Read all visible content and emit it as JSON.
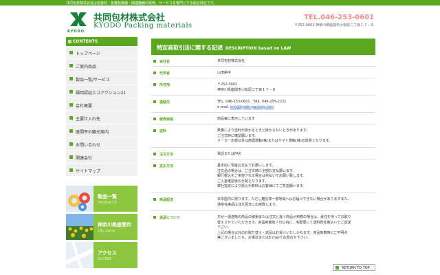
{
  "topbar": {
    "text": "共同包材株式会社は包装材・各種包装機・関連機器の販売、サービスを専門とする総合商社です。"
  },
  "header": {
    "logo_jp": "共同包材株式会社",
    "logo_en": "KYODO Packing materials",
    "logo_mark_text": "KYODO",
    "tel": "TEL.046-253-0601",
    "address": "〒252-0002 神奈川県座間市小松原二丁目１７－８"
  },
  "sidebar": {
    "heading": "CONTENTS",
    "items": [
      {
        "label": "トップページ"
      },
      {
        "label": "ご案内商品"
      },
      {
        "label": "製品一覧/サービス"
      },
      {
        "label": "福岡認証エコアクション21"
      },
      {
        "label": "会社概要"
      },
      {
        "label": "主要仕入れ先"
      },
      {
        "label": "座間市の観光案内"
      },
      {
        "label": "お問い合わせ"
      },
      {
        "label": "関連会社"
      },
      {
        "label": "サイトマップ"
      }
    ]
  },
  "banners": [
    {
      "title": "製品一覧",
      "sub": "PRODUCTS"
    },
    {
      "title": "神奈川県座間市",
      "sub": "City zama"
    },
    {
      "title": "アクセス",
      "sub": "ACCESS"
    }
  ],
  "main": {
    "title": "特定商取引法に関する記述",
    "title_en": "DESCRIPTION based on LAW",
    "rows": [
      {
        "label": "会社名",
        "lines": [
          "共同包材株式会社"
        ]
      },
      {
        "label": "代表者",
        "lines": [
          "山田耕平"
        ]
      },
      {
        "label": "所在地",
        "lines": [
          "〒252-0002",
          "神奈川県座間市小松原二丁目１７－８"
        ]
      },
      {
        "label": "連絡先",
        "lines": [
          "TEL. 046-253-0601　FAX. 046-255-2221"
        ],
        "email_prefix": "e-mail. ",
        "email": "info@kyodo-packing.com"
      },
      {
        "label": "販売価格",
        "lines": [
          "商品毎に表示しています"
        ]
      },
      {
        "label": "送料",
        "lines": [
          "数量により送料が掛かるときと掛からないときがあります。",
          "ご注文時に確認願います。",
          "メーカー出荷以外は西濃運輸(株)またはヤマト運輸(株)の運賃となります。"
        ]
      },
      {
        "label": "注文方法",
        "lines": [
          "電話またはFAX"
        ]
      },
      {
        "label": "支払方法",
        "lines": [
          "基本的に現金お支払でお願いします。",
          "注文品の場合は、ご注文時に全額お支払願います。",
          "銀行振込をご希望される場合は先払いでお願い致します。",
          "ご入金確認後の手配となります。",
          "弊社指定により振込手数料はお客様にてご負担願います。"
        ]
      },
      {
        "label": "商品配送",
        "lines": [
          "日本国内に限ります。ただし離島等一部地域へはお届けできない場合がありますまた、",
          "通常在庫品は注文翌日に出荷致します。"
        ]
      },
      {
        "label": "返品について",
        "lines": [
          "万が一運送時の商品の破損または注文と違う商品が到着の場合は、責任を持ってお取り",
          "替えさせていただきます。商品到着後７日以内に、宅配便にて送料弊社着払いでご返送",
          "下さい。",
          "上記の場合以外のお取り替え・返品はお受けいたしかねます。商品到着時にご不明点",
          "等ございましたら、お電話またはE-mailでお問合せ下さい。"
        ]
      }
    ]
  },
  "footer": {
    "return_to_top": "RETURN TO TOP"
  }
}
